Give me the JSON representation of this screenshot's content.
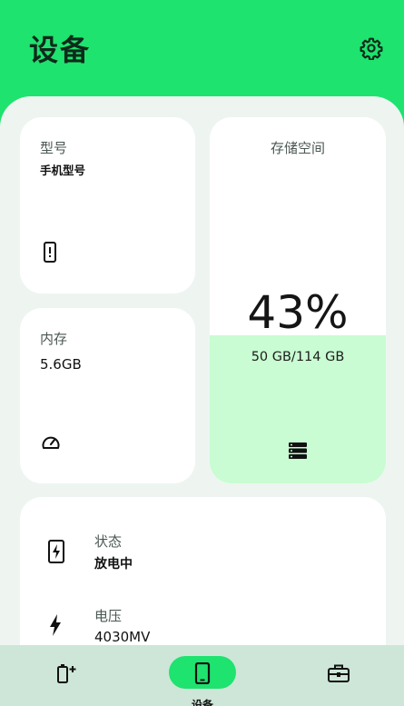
{
  "header": {
    "title": "设备"
  },
  "cards": {
    "model": {
      "label": "型号",
      "value": "手机型号"
    },
    "memory": {
      "label": "内存",
      "value": "5.6GB"
    },
    "storage": {
      "label": "存储空间",
      "percent": "43%",
      "capacity": "50 GB/114 GB",
      "used_fraction": 0.43
    }
  },
  "info": {
    "status": {
      "label": "状态",
      "value": "放电中"
    },
    "voltage": {
      "label": "电压",
      "value": "4030MV"
    }
  },
  "nav": {
    "items": [
      {
        "icon": "battery-charge-icon"
      },
      {
        "icon": "phone-icon",
        "label": "设备",
        "active": true
      },
      {
        "icon": "toolbox-icon"
      }
    ]
  },
  "colors": {
    "accent": "#1ee36f",
    "sheet": "#eef5f1",
    "storage_fill": "#c9fcd2",
    "nav_bg": "#cde6d8"
  }
}
